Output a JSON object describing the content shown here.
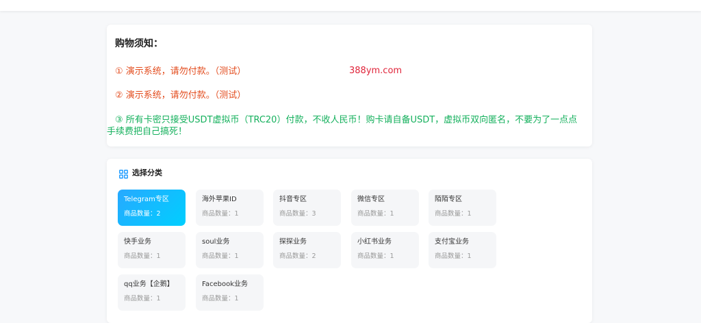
{
  "notice": {
    "title": "购物须知：",
    "line1": "① 演示系统，请勿付款。（测试）",
    "line2": "② 演示系统，请勿付款。（测试）",
    "line3a": "③  所有卡密只接受USDT虚拟币（TRC20）付款，不收人民币！购卡请自备USDT，虚拟币双向匿名，不要为了一点点",
    "line3b": "手续费把自己搞死！",
    "watermark": "388ym.com"
  },
  "categories": {
    "title": "选择分类",
    "icon": "category-grid-icon",
    "count_prefix": "商品数量：",
    "items": [
      {
        "name": "Telegram专区",
        "count": "商品数量：2",
        "active": true
      },
      {
        "name": "海外苹果ID",
        "count": "商品数量：1"
      },
      {
        "name": "抖音专区",
        "count": "商品数量：3"
      },
      {
        "name": "微信专区",
        "count": "商品数量：1"
      },
      {
        "name": "陌陌专区",
        "count": "商品数量：1"
      },
      {
        "name": "快手业务",
        "count": "商品数量：1"
      },
      {
        "name": "soul业务",
        "count": "商品数量：1"
      },
      {
        "name": "探探业务",
        "count": "商品数量：2"
      },
      {
        "name": "小红书业务",
        "count": "商品数量：1"
      },
      {
        "name": "支付宝业务",
        "count": "商品数量：1"
      },
      {
        "name": "qq业务【企鹅】",
        "count": "商品数量：1"
      },
      {
        "name": "Facebook业务",
        "count": "商品数量：1"
      }
    ]
  },
  "colors": {
    "accent": "#1e9bff",
    "notice_red": "#e34d1f",
    "notice_green": "#14b05c"
  }
}
